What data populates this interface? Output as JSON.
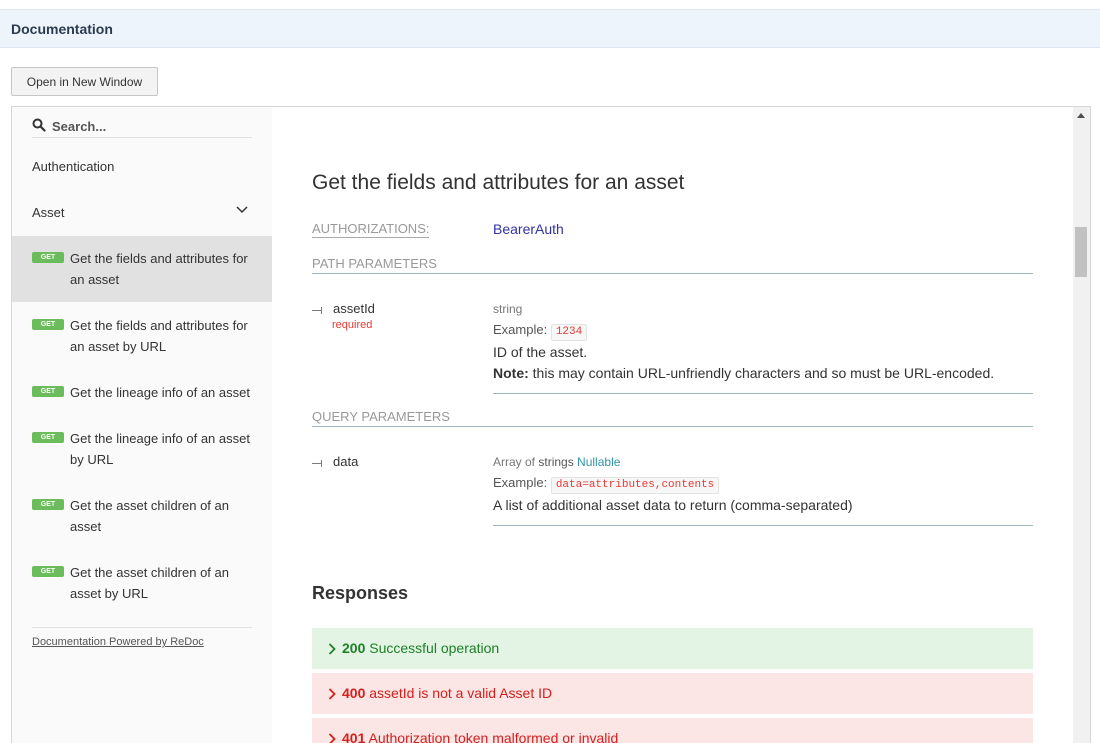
{
  "header": {
    "title": "Documentation"
  },
  "toolbar": {
    "open_new_window": "Open in New Window"
  },
  "sidebar": {
    "search_placeholder": "Search...",
    "sections": [
      {
        "label": "Authentication"
      },
      {
        "label": "Asset",
        "expanded": true
      }
    ],
    "operations": [
      {
        "method": "GET",
        "line1": "Get the fields and attributes for",
        "line2": "an asset",
        "active": true
      },
      {
        "method": "GET",
        "line1": "Get the fields and attributes for",
        "line2": "an asset by URL"
      },
      {
        "method": "GET",
        "line1": "Get the lineage info of an asset",
        "line2": ""
      },
      {
        "method": "GET",
        "line1": "Get the lineage info of an asset",
        "line2": "by URL"
      },
      {
        "method": "GET",
        "line1": "Get the asset children of an",
        "line2": "asset"
      },
      {
        "method": "GET",
        "line1": "Get the asset children of an",
        "line2": "asset by URL"
      }
    ],
    "powered_by": "Documentation Powered by ReDoc"
  },
  "operation": {
    "title": "Get the fields and attributes for an asset",
    "authorizations_label": "AUTHORIZATIONS:",
    "authorizations_value": "BearerAuth",
    "path_params_label": "PATH PARAMETERS",
    "path_param": {
      "name": "assetId",
      "required": "required",
      "type": "string",
      "example_label": "Example:",
      "example": "1234",
      "description": "ID of the asset.",
      "note_label": "Note:",
      "note": " this may contain URL-unfriendly characters and so must be URL-encoded."
    },
    "query_params_label": "QUERY PARAMETERS",
    "query_param": {
      "name": "data",
      "type_prefix": "Array of ",
      "type_strong": "strings",
      "nullable": "Nullable",
      "example_label": "Example:",
      "example": "data=attributes,contents",
      "description": "A list of additional asset data to return (comma-separated)"
    }
  },
  "responses": {
    "title": "Responses",
    "items": [
      {
        "code": "200",
        "text": "Successful operation",
        "kind": "ok"
      },
      {
        "code": "400",
        "text": "assetId is not a valid Asset ID",
        "kind": "err"
      },
      {
        "code": "401",
        "text": "Authorization token malformed or invalid",
        "kind": "err"
      }
    ]
  },
  "colors": {
    "header_bg": "#eef4fc",
    "get_badge": "#6bbd5b",
    "auth_link": "#32329f",
    "required": "#e53935",
    "nullable": "#3195a7",
    "resp_ok_bg": "#e3f4e4",
    "resp_ok_text": "#1d8127",
    "resp_err_bg": "#fbe5e5",
    "resp_err_text": "#d41f1c"
  }
}
